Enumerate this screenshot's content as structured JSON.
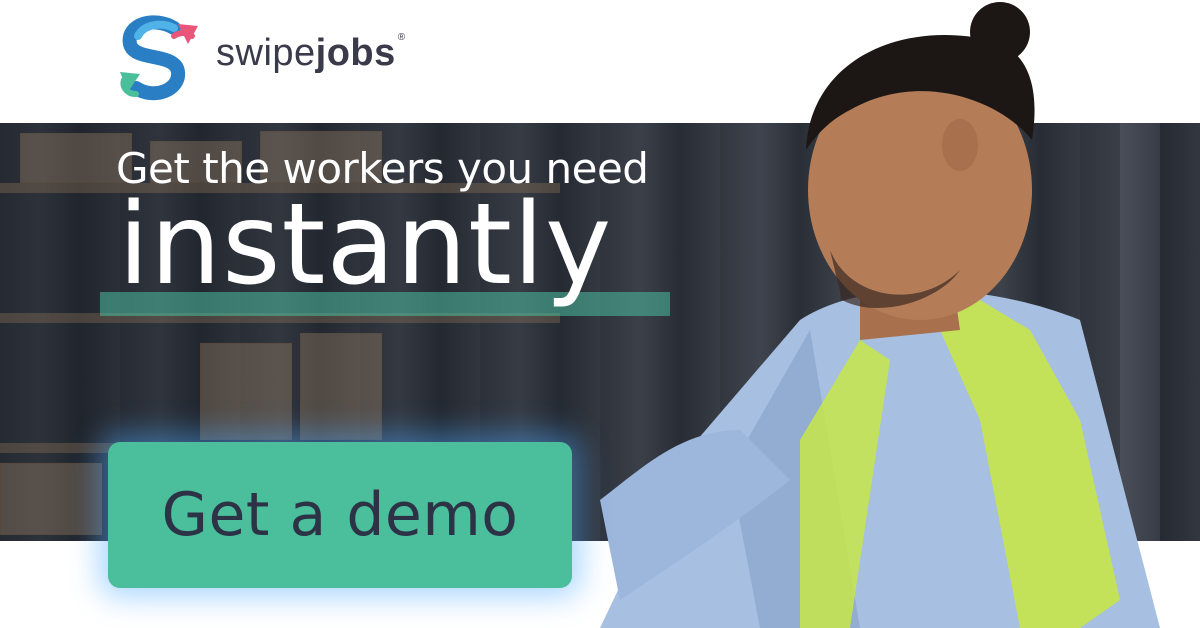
{
  "brand": {
    "name_light": "swipe",
    "name_bold": "jobs",
    "registered_mark": "®",
    "logo_icon": "swipejobs-s-logo-icon",
    "colors": {
      "pink": "#e8577a",
      "teal": "#4bbf9c",
      "blue": "#2a7fc4",
      "text": "#3a3a4a"
    }
  },
  "headline": {
    "line1": "Get the workers you need",
    "line2": "instantly"
  },
  "cta": {
    "label": "Get a demo",
    "color": "#4bbf9c"
  }
}
